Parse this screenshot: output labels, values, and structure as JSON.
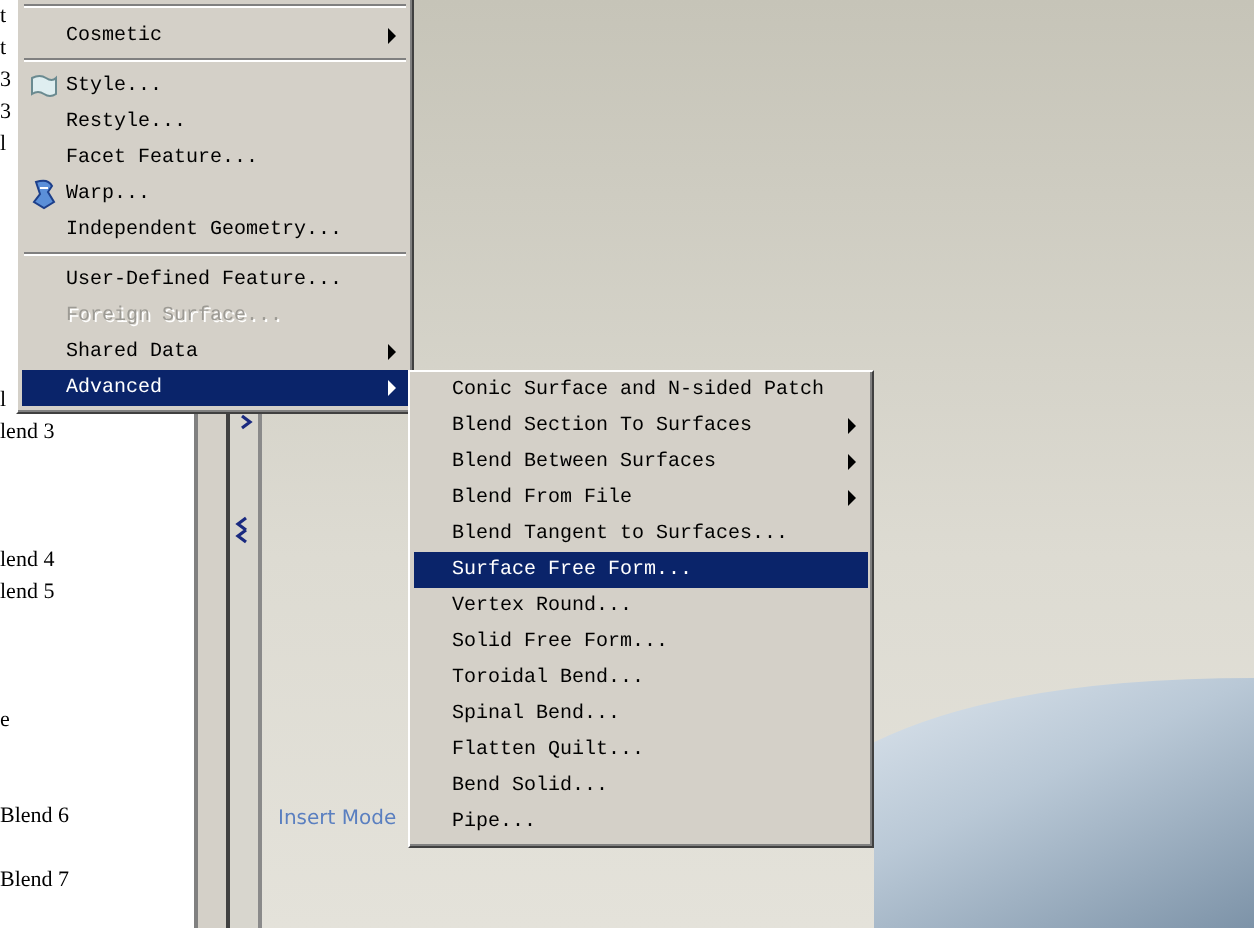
{
  "tree": {
    "lines": [
      "t",
      "t",
      "3",
      "3",
      "l",
      "l",
      "lend 3",
      "lend 4",
      "lend 5",
      "e",
      "Blend 6",
      "Blend 7"
    ]
  },
  "status": {
    "mode": "Insert Mode"
  },
  "menu": {
    "items": [
      {
        "kind": "item",
        "label": "Cosmetic",
        "submenu": true,
        "selected": false,
        "disabled": false
      },
      {
        "kind": "separator"
      },
      {
        "kind": "item_flag",
        "label": "Style...",
        "submenu": false,
        "selected": false,
        "disabled": false
      },
      {
        "kind": "item",
        "label": "Restyle...",
        "submenu": false,
        "selected": false,
        "disabled": false
      },
      {
        "kind": "item",
        "label": "Facet Feature...",
        "submenu": false,
        "selected": false,
        "disabled": false
      },
      {
        "kind": "item_figure",
        "label": "Warp...",
        "submenu": false,
        "selected": false,
        "disabled": false
      },
      {
        "kind": "item",
        "label": "Independent Geometry...",
        "submenu": false,
        "selected": false,
        "disabled": false
      },
      {
        "kind": "separator"
      },
      {
        "kind": "item",
        "label": "User-Defined Feature...",
        "submenu": false,
        "selected": false,
        "disabled": false
      },
      {
        "kind": "item",
        "label": "Foreign Surface...",
        "submenu": false,
        "selected": false,
        "disabled": true
      },
      {
        "kind": "item",
        "label": "Shared Data",
        "submenu": true,
        "selected": false,
        "disabled": false
      },
      {
        "kind": "item",
        "label": "Advanced",
        "submenu": true,
        "selected": true,
        "disabled": false
      }
    ]
  },
  "submenu": {
    "items": [
      {
        "label": "Conic Surface and N-sided Patch",
        "submenu": false,
        "selected": false
      },
      {
        "label": "Blend Section To Surfaces",
        "submenu": true,
        "selected": false
      },
      {
        "label": "Blend Between Surfaces",
        "submenu": true,
        "selected": false
      },
      {
        "label": "Blend From File",
        "submenu": true,
        "selected": false
      },
      {
        "label": "Blend Tangent to Surfaces...",
        "submenu": false,
        "selected": false
      },
      {
        "label": "Surface Free Form...",
        "submenu": false,
        "selected": true
      },
      {
        "label": "Vertex Round...",
        "submenu": false,
        "selected": false
      },
      {
        "label": "Solid Free Form...",
        "submenu": false,
        "selected": false
      },
      {
        "label": "Toroidal Bend...",
        "submenu": false,
        "selected": false
      },
      {
        "label": "Spinal Bend...",
        "submenu": false,
        "selected": false
      },
      {
        "label": "Flatten Quilt...",
        "submenu": false,
        "selected": false
      },
      {
        "label": "Bend Solid...",
        "submenu": false,
        "selected": false
      },
      {
        "label": "Pipe...",
        "submenu": false,
        "selected": false
      }
    ]
  }
}
